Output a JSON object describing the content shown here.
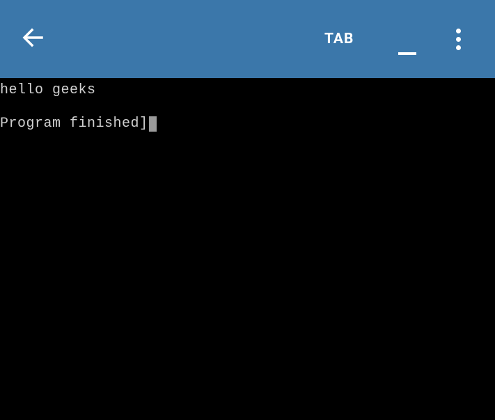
{
  "toolbar": {
    "tab_label": "TAB"
  },
  "terminal": {
    "line1": "hello geeks",
    "line2": "Program finished]"
  }
}
